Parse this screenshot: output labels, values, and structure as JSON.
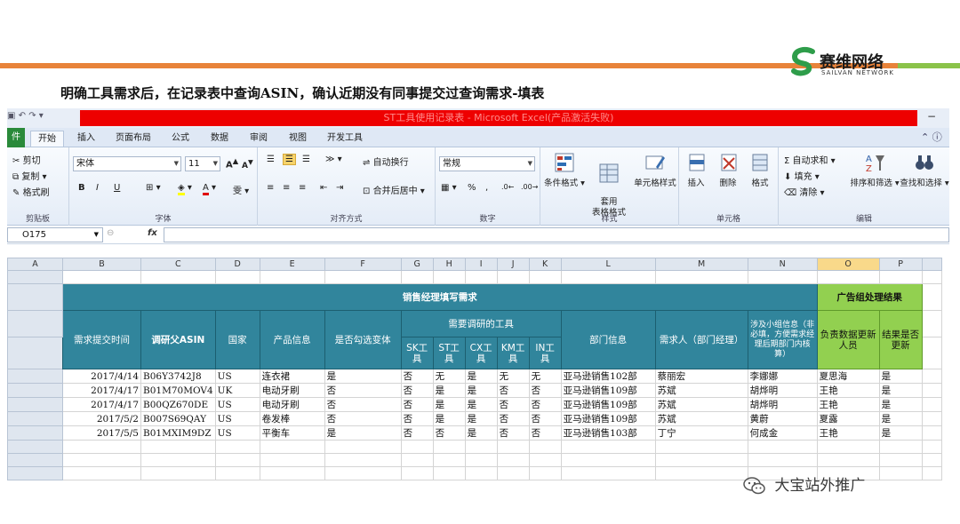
{
  "slide": {
    "caption": "明确工具需求后，在记录表中查询ASIN，确认近期没有同事提交过查询需求-填表",
    "logo_name": "赛维网络",
    "logo_sub": "SAILVAN NETWORK",
    "watermark": "大宝站外推广",
    "accent_orange": "#e8833a",
    "accent_green": "#8bc34a"
  },
  "excel": {
    "title": "ST工具使用记录表 - Microsoft Excel(产品激活失败)",
    "tabs": [
      "件",
      "开始",
      "插入",
      "页面布局",
      "公式",
      "数据",
      "审阅",
      "视图",
      "开发工具"
    ],
    "ribbon": {
      "clipboard": {
        "cut": "剪切",
        "copy": "复制 ▾",
        "format_painter": "格式刷",
        "label": "剪贴板"
      },
      "font": {
        "name": "宋体",
        "size": "11",
        "grow": "A",
        "shrink": "A",
        "bold": "B",
        "italic": "I",
        "underline": "U",
        "label": "字体"
      },
      "align": {
        "wrap": "自动换行",
        "merge": "合并后居中 ▾",
        "label": "对齐方式"
      },
      "number": {
        "format": "常规",
        "percent": "%",
        "comma": ",",
        "label": "数字"
      },
      "styles": {
        "cond": "条件格式",
        "table": "套用\n表格格式",
        "cell": "单元格样式",
        "label": "样式"
      },
      "cells": {
        "insert": "插入",
        "delete": "删除",
        "format": "格式",
        "label": "单元格"
      },
      "edit": {
        "autosum": "Σ 自动求和 ▾",
        "fill": "填充 ▾",
        "clear": "清除 ▾",
        "sort": "排序和筛选",
        "find": "查找和选择",
        "label": "编辑"
      }
    },
    "namebox": "O175",
    "fx": "fx",
    "columns": [
      "A",
      "B",
      "C",
      "D",
      "E",
      "F",
      "G",
      "H",
      "I",
      "J",
      "K",
      "L",
      "M",
      "N",
      "O",
      "P"
    ],
    "header": {
      "group_left": "销售经理填写需求",
      "group_right": "广告组处理结果",
      "tools_group": "需要调研的工具",
      "col_time": "需求提交时间",
      "col_asin": "调研父ASIN",
      "col_country": "国家",
      "col_product": "产品信息",
      "col_variant": "是否勾选变体",
      "tools": [
        "SK工具",
        "ST工具",
        "CX工具",
        "KM工具",
        "IN工具"
      ],
      "col_dept": "部门信息",
      "col_requester": "需求人（部门经理）",
      "col_team": "涉及小组信息（非必填，方便需求经理后期部门内核算）",
      "col_owner": "负责数据更新人员",
      "col_updated": "结果是否更新"
    },
    "rows": [
      {
        "time": "2017/4/14",
        "asin": "B06Y3742J8",
        "country": "US",
        "product": "连衣裙",
        "variant": "是",
        "sk": "否",
        "st": "无",
        "cx": "是",
        "km": "无",
        "in": "无",
        "dept": "亚马逊销售102部",
        "requester": "蔡丽宏",
        "team": "李娜娜",
        "owner": "夏思海",
        "updated": "是"
      },
      {
        "time": "2017/4/17",
        "asin": "B01M70MOV4",
        "country": "UK",
        "product": "电动牙刷",
        "variant": "否",
        "sk": "否",
        "st": "是",
        "cx": "是",
        "km": "否",
        "in": "否",
        "dept": "亚马逊销售109部",
        "requester": "苏斌",
        "team": "胡烨明",
        "owner": "王艳",
        "updated": "是"
      },
      {
        "time": "2017/4/17",
        "asin": "B00QZ670DE",
        "country": "US",
        "product": "电动牙刷",
        "variant": "否",
        "sk": "否",
        "st": "是",
        "cx": "是",
        "km": "否",
        "in": "否",
        "dept": "亚马逊销售109部",
        "requester": "苏斌",
        "team": "胡烨明",
        "owner": "王艳",
        "updated": "是"
      },
      {
        "time": "2017/5/2",
        "asin": "B007S69QAY",
        "country": "US",
        "product": "卷发棒",
        "variant": "否",
        "sk": "否",
        "st": "是",
        "cx": "是",
        "km": "否",
        "in": "否",
        "dept": "亚马逊销售109部",
        "requester": "苏斌",
        "team": "黄蔚",
        "owner": "夏露",
        "updated": "是"
      },
      {
        "time": "2017/5/5",
        "asin": "B01MXIM9DZ",
        "country": "US",
        "product": "平衡车",
        "variant": "是",
        "sk": "否",
        "st": "否",
        "cx": "是",
        "km": "否",
        "in": "否",
        "dept": "亚马逊销售103部",
        "requester": "丁宁",
        "team": "何成金",
        "owner": "王艳",
        "updated": "是"
      }
    ]
  }
}
